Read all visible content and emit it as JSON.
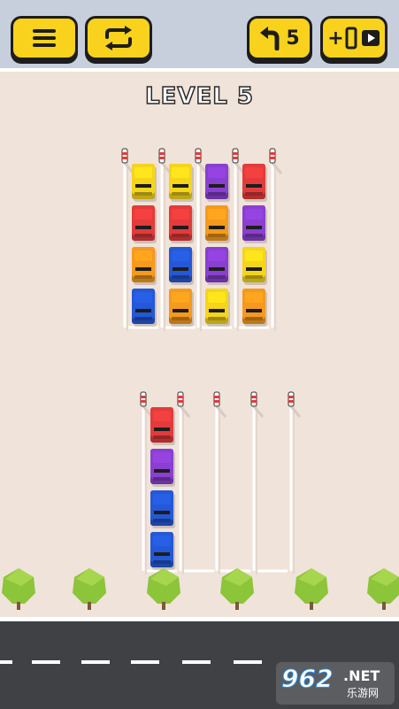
{
  "header": {
    "menu_icon": "hamburger-menu-icon",
    "restart_icon": "restart-arrows-icon",
    "undo_icon": "undo-arrow-icon",
    "undo_count": "5",
    "add_lane_plus": "+",
    "add_lane_icon": "parking-lane-icon",
    "video_icon": "play-video-icon"
  },
  "level": {
    "title": "LEVEL 5"
  },
  "colors": {
    "yellow": "#f5d51a",
    "red": "#e33b3b",
    "purple": "#8a3fd1",
    "orange": "#f59a1c",
    "blue": "#2458d6",
    "button": "#f8d21c",
    "ground": "#f0e3da",
    "road": "#3f4145"
  },
  "top_lot": {
    "columns": [
      [
        "yellow",
        "red",
        "orange",
        "blue"
      ],
      [
        "yellow",
        "red",
        "blue",
        "orange"
      ],
      [
        "purple",
        "orange",
        "purple",
        "yellow"
      ],
      [
        "red",
        "purple",
        "yellow",
        "orange"
      ]
    ]
  },
  "bottom_lot": {
    "columns": [
      [
        "red",
        "purple",
        "blue",
        "blue"
      ],
      [],
      [],
      []
    ]
  },
  "watermark": {
    "number": "962",
    "domain": ".NET",
    "chinese": "乐游网"
  }
}
